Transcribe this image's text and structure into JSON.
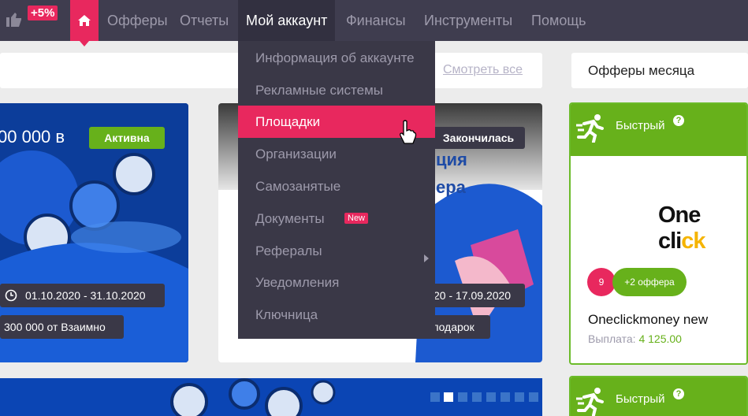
{
  "nav": {
    "bonus": "+5%",
    "items": [
      "Офферы",
      "Отчеты",
      "Мой аккаунт",
      "Финансы",
      "Инструменты",
      "Помощь"
    ]
  },
  "dropdown": {
    "items": [
      "Информация об аккаунте",
      "Рекламные системы",
      "Площадки",
      "Организации",
      "Самозанятые",
      "Документы",
      "Рефералы",
      "Уведомления",
      "Ключница"
    ],
    "new_badge": "New"
  },
  "see_all": "Смотреть все",
  "offers_month": "Офферы месяца",
  "card1": {
    "title": "00 000 в",
    "status": "Активна",
    "dates": "01.10.2020 - 31.10.2020",
    "prize": "300 000 от Взаимно"
  },
  "card2": {
    "status": "Закончилась",
    "line1": "ция",
    "line2": "ера",
    "dates": "20 - 17.09.2020",
    "prize": "подарок"
  },
  "offers": [
    {
      "speed": "Быстрый",
      "logo_a": "One cli",
      "logo_b": "ck",
      "count": "9",
      "more": "+2 оффера",
      "name": "Oneclickmoney new",
      "payout_label": "Выплата:",
      "payout_value": "4 125.00"
    },
    {
      "speed": "Быстрый"
    }
  ],
  "colors": {
    "accent": "#e8285e",
    "green": "#67b11b",
    "nav": "#3f3d4f"
  }
}
